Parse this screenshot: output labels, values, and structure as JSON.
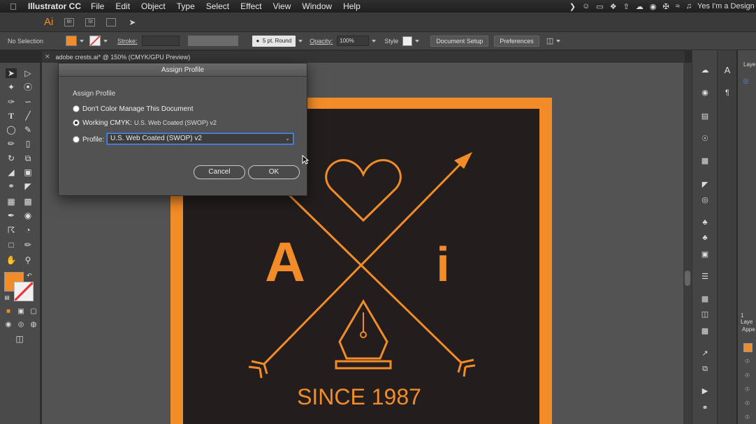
{
  "menubar": {
    "app_name": "Illustrator CC",
    "items": [
      "File",
      "Edit",
      "Object",
      "Type",
      "Select",
      "Effect",
      "View",
      "Window",
      "Help"
    ],
    "user_text": "Yes I'm a Design"
  },
  "appbar": {
    "logo": "Ai",
    "br_icon": "Br",
    "st_icon": "St"
  },
  "controlbar": {
    "selection": "No Selection",
    "stroke_label": "Stroke:",
    "brush": "5 pt. Round",
    "opacity_label": "Opacity:",
    "opacity_value": "100%",
    "style_label": "Style",
    "document_setup": "Document Setup",
    "preferences": "Preferences"
  },
  "tab": {
    "title": "adobe crests.ai* @ 150% (CMYK/GPU Preview)"
  },
  "layers_panel": {
    "label": "Laye",
    "count_label": "1 Laye",
    "appearance_label": "Appe"
  },
  "artwork": {
    "letter_a": "A",
    "letter_i": "i",
    "since": "SINCE 1987",
    "orange": "#f28c28",
    "dark": "#231e1d"
  },
  "dialog": {
    "title": "Assign Profile",
    "section": "Assign Profile",
    "option_dont": "Don't Color Manage This Document",
    "option_working": "Working CMYK:",
    "option_working_value": "U.S. Web Coated (SWOP) v2",
    "option_profile": "Profile:",
    "profile_value": "U.S. Web Coated (SWOP) v2",
    "cancel": "Cancel",
    "ok": "OK",
    "selected_option": "working"
  }
}
